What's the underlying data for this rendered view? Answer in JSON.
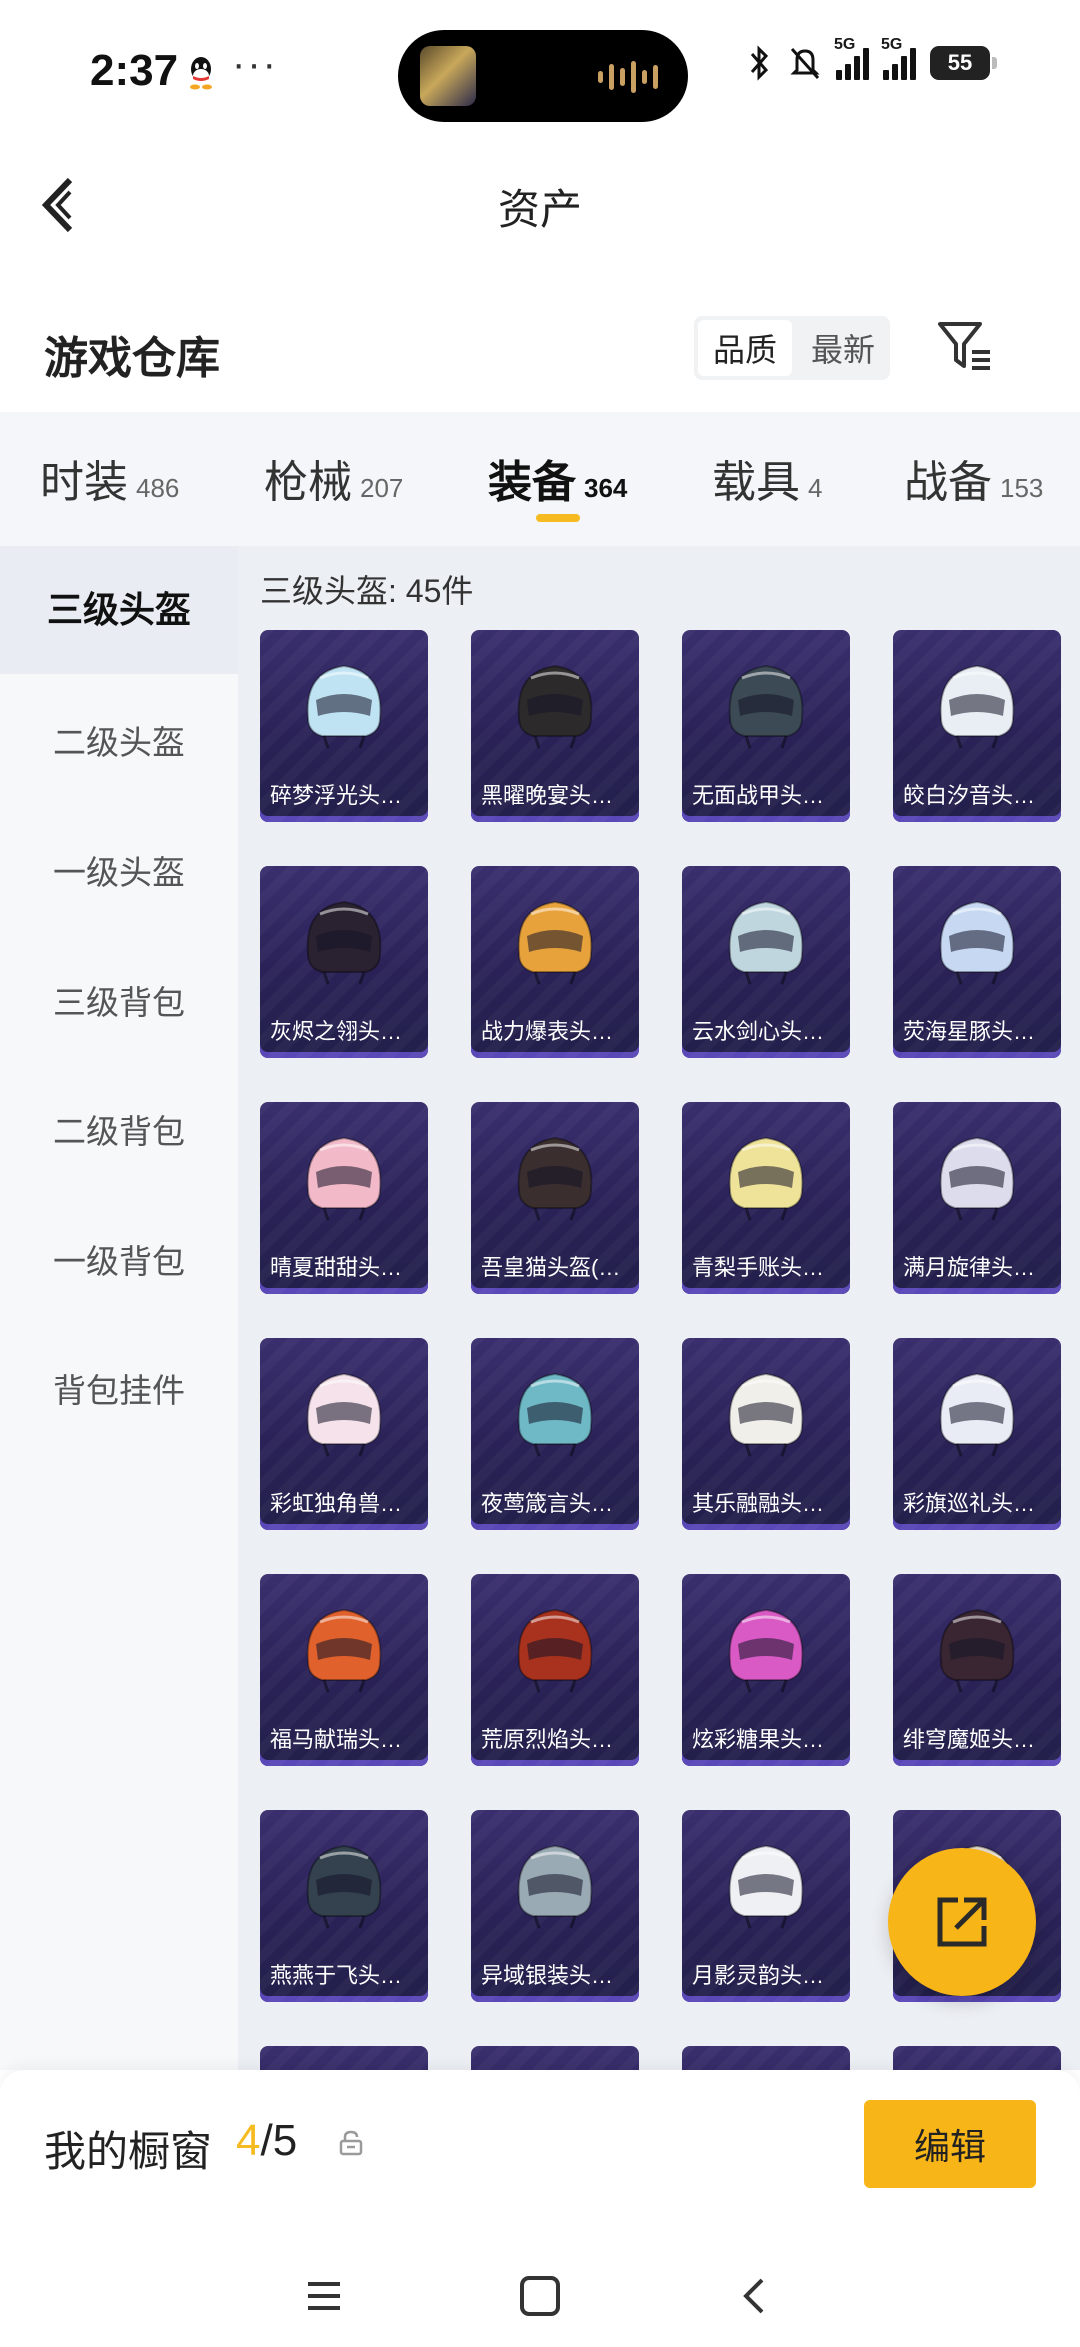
{
  "status_bar": {
    "time": "2:37",
    "dots": "···",
    "battery": "55",
    "sig1": "5G",
    "sig2": "5G"
  },
  "header": {
    "title": "资产"
  },
  "warehouse": {
    "title": "游戏仓库",
    "sort": {
      "quality": "品质",
      "newest": "最新"
    }
  },
  "tabs": [
    {
      "label": "时装",
      "count": "486"
    },
    {
      "label": "枪械",
      "count": "207"
    },
    {
      "label": "装备",
      "count": "364"
    },
    {
      "label": "载具",
      "count": "4"
    },
    {
      "label": "战备",
      "count": "153"
    }
  ],
  "sidebar": {
    "items": [
      {
        "label": "三级头盔"
      },
      {
        "label": "二级头盔"
      },
      {
        "label": "一级头盔"
      },
      {
        "label": "三级背包"
      },
      {
        "label": "二级背包"
      },
      {
        "label": "一级背包"
      },
      {
        "label": "背包挂件"
      }
    ]
  },
  "content": {
    "count_label": "三级头盔: 45件"
  },
  "items": [
    {
      "name": "碎梦浮光头…",
      "color": "#bfe3f2"
    },
    {
      "name": "黑曜晚宴头…",
      "color": "#2d2a2c"
    },
    {
      "name": "无面战甲头…",
      "color": "#3c4a55"
    },
    {
      "name": "皎白汐音头…",
      "color": "#e8eef3"
    },
    {
      "name": "灰烬之翎头…",
      "color": "#2a2230"
    },
    {
      "name": "战力爆表头…",
      "color": "#e8a23c"
    },
    {
      "name": "云水剑心头…",
      "color": "#bfd6df"
    },
    {
      "name": "荧海星豚头…",
      "color": "#c6d8f2"
    },
    {
      "name": "晴夏甜甜头…",
      "color": "#f2b9c8"
    },
    {
      "name": "吾皇猫头盔(…",
      "color": "#3a2e2e"
    },
    {
      "name": "青梨手账头…",
      "color": "#efe39a"
    },
    {
      "name": "满月旋律头…",
      "color": "#dcdcec"
    },
    {
      "name": "彩虹独角兽…",
      "color": "#f5e2ea"
    },
    {
      "name": "夜莺箴言头…",
      "color": "#6fb8c6"
    },
    {
      "name": "其乐融融头…",
      "color": "#f1efe9"
    },
    {
      "name": "彩旗巡礼头…",
      "color": "#e9ecf5"
    },
    {
      "name": "福马献瑞头…",
      "color": "#e0612c"
    },
    {
      "name": "荒原烈焰头…",
      "color": "#a8321e"
    },
    {
      "name": "炫彩糖果头…",
      "color": "#d95ac5"
    },
    {
      "name": "绯穹魔姬头…",
      "color": "#3a2632"
    },
    {
      "name": "燕燕于飞头…",
      "color": "#33424e"
    },
    {
      "name": "异域银装头…",
      "color": "#9aaab4"
    },
    {
      "name": "月影灵韵头…",
      "color": "#eef0f4"
    },
    {
      "name": "",
      "color": "#e7ddd0"
    }
  ],
  "showcase": {
    "label": "我的橱窗",
    "current": "4",
    "total": "/5",
    "edit": "编辑"
  },
  "colors": {
    "accent": "#f5bb21",
    "card_bg": "#2a2257"
  },
  "icons": [
    "back-arrow-icon",
    "filter-icon",
    "share-icon",
    "lock-icon",
    "menu-icon",
    "home-icon",
    "back-icon"
  ]
}
